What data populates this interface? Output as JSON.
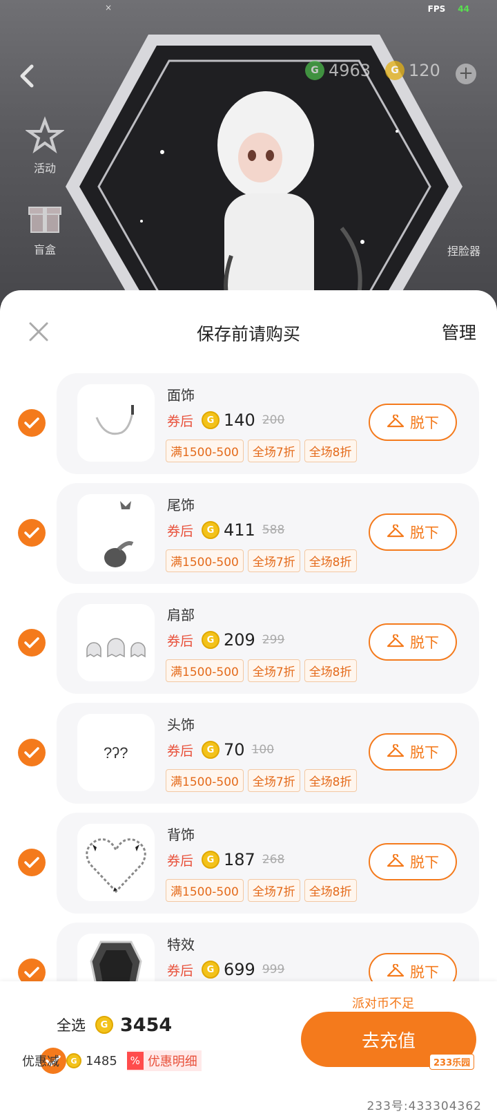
{
  "status": {
    "fps_label": "FPS",
    "fps_value": "44",
    "close_mark": "×"
  },
  "header": {
    "party_coins": "4963",
    "gold_coins": "120",
    "side_buttons": {
      "activity": "活动",
      "blindbox": "盲盒",
      "selfie": "捏脸器"
    }
  },
  "sheet": {
    "title": "保存前请购买",
    "manage": "管理"
  },
  "coupon_tag": "券后",
  "takeoff_label": "脱下",
  "items": [
    {
      "name": "面饰",
      "price": "140",
      "original": "200",
      "tags": [
        "满1500-500",
        "全场7折",
        "全场8折"
      ],
      "thumb": "chain-face-accessory"
    },
    {
      "name": "尾饰",
      "price": "411",
      "original": "588",
      "tags": [
        "满1500-500",
        "全场7折",
        "全场8折"
      ],
      "thumb": "tail-ornament"
    },
    {
      "name": "肩部",
      "price": "209",
      "original": "299",
      "tags": [
        "满1500-500",
        "全场7折",
        "全场8折"
      ],
      "thumb": "ghost-shoulder"
    },
    {
      "name": "头饰",
      "price": "70",
      "original": "100",
      "tags": [
        "满1500-500",
        "全场7折",
        "全场8折"
      ],
      "thumb": "question-headpiece"
    },
    {
      "name": "背饰",
      "price": "187",
      "original": "268",
      "tags": [
        "满1500-500",
        "全场7折",
        "全场8折"
      ],
      "thumb": "heart-chain-back"
    },
    {
      "name": "特效",
      "price": "699",
      "original": "999",
      "tags": [],
      "thumb": "coffin-effect"
    }
  ],
  "footer": {
    "insufficient": "派对币不足",
    "select_all": "全选",
    "total": "3454",
    "discount_label": "优惠减",
    "discount_value": "1485",
    "detail_label": "优惠明细",
    "detail_icon": "%",
    "recharge": "去充值",
    "badge": "233乐园",
    "watermark": "233号:433304362"
  },
  "colors": {
    "accent": "#f47a1c",
    "coupon_red": "#e8503a",
    "coin_gold": "#f3c21a",
    "party_coin_green": "#4cb84a"
  }
}
